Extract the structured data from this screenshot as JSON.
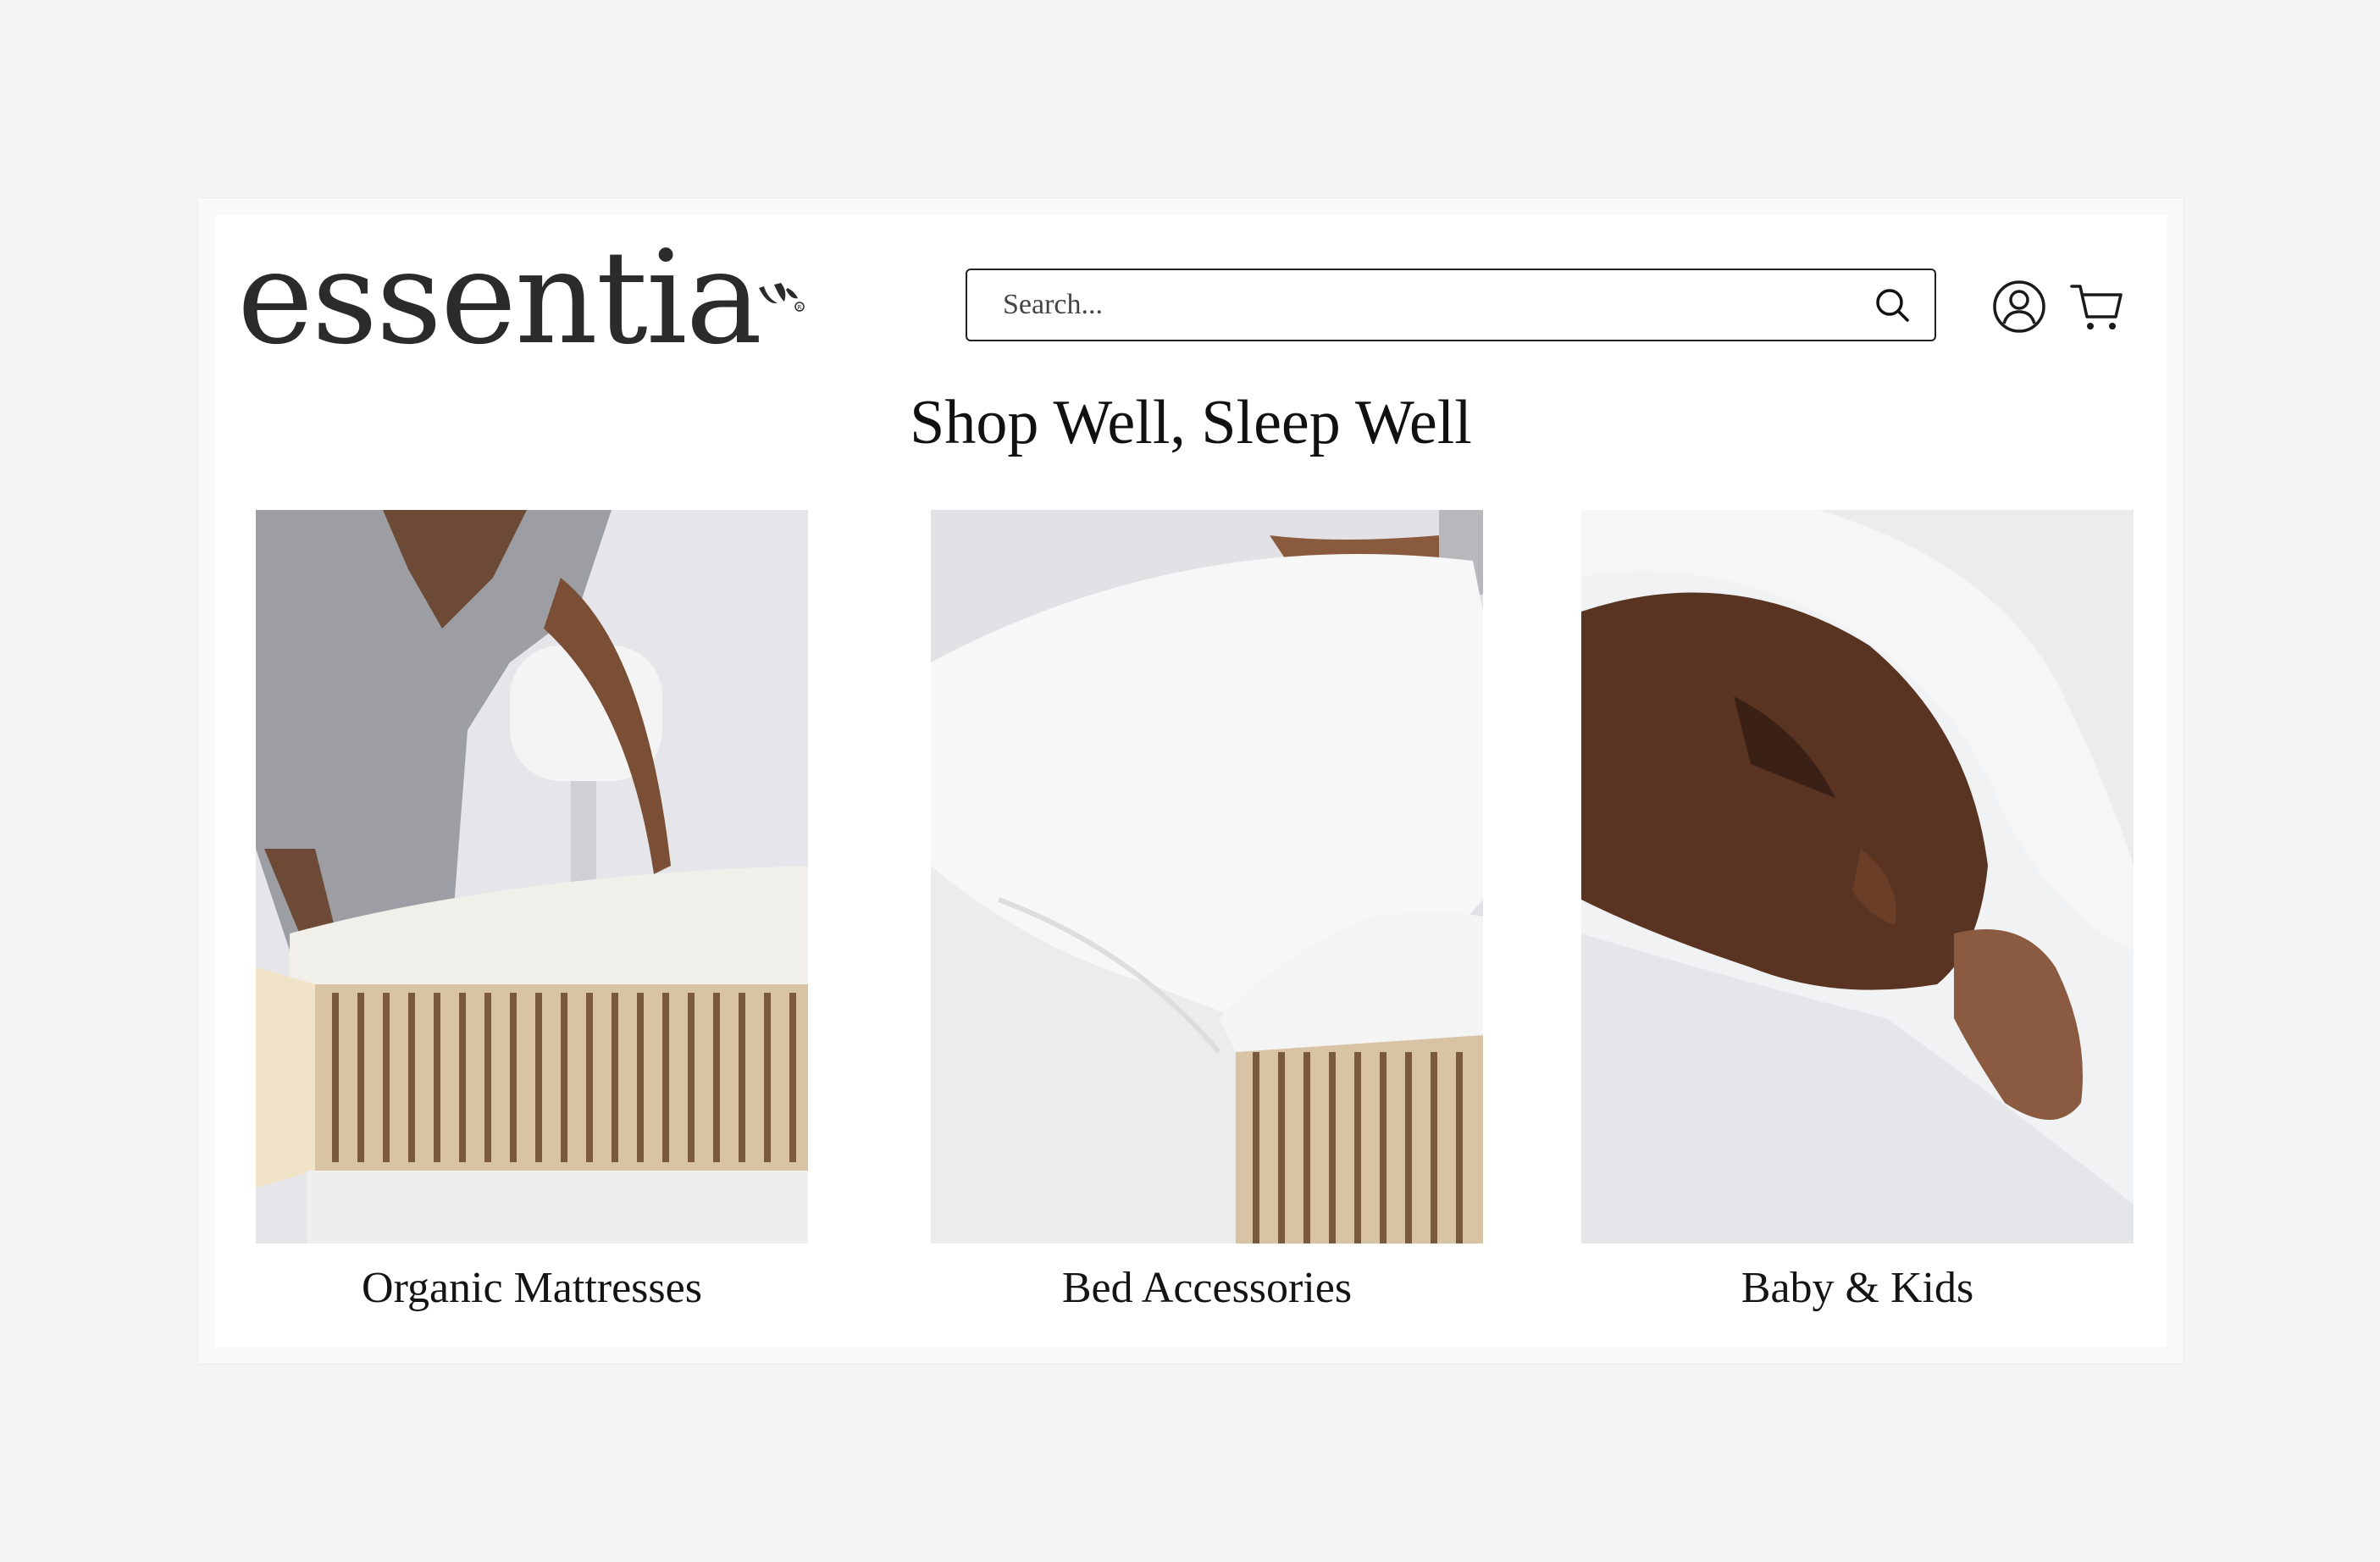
{
  "header": {
    "logo_text": "essentia",
    "search": {
      "placeholder": "Search..."
    },
    "icons": [
      "user-icon",
      "cart-icon",
      "search-icon"
    ]
  },
  "main": {
    "title": "Shop Well, Sleep Well",
    "categories": [
      {
        "label": "Organic Mattresses",
        "image": "woman-making-bed-on-mattress"
      },
      {
        "label": "Bed Accessories",
        "image": "white-sheet-over-mattress"
      },
      {
        "label": "Baby & Kids",
        "image": "sleeping-baby-under-blanket"
      }
    ]
  },
  "colors": {
    "page_bg": "#f5f5f5",
    "panel_bg": "#ffffff",
    "text": "#1a1a1a",
    "border": "#222222"
  }
}
